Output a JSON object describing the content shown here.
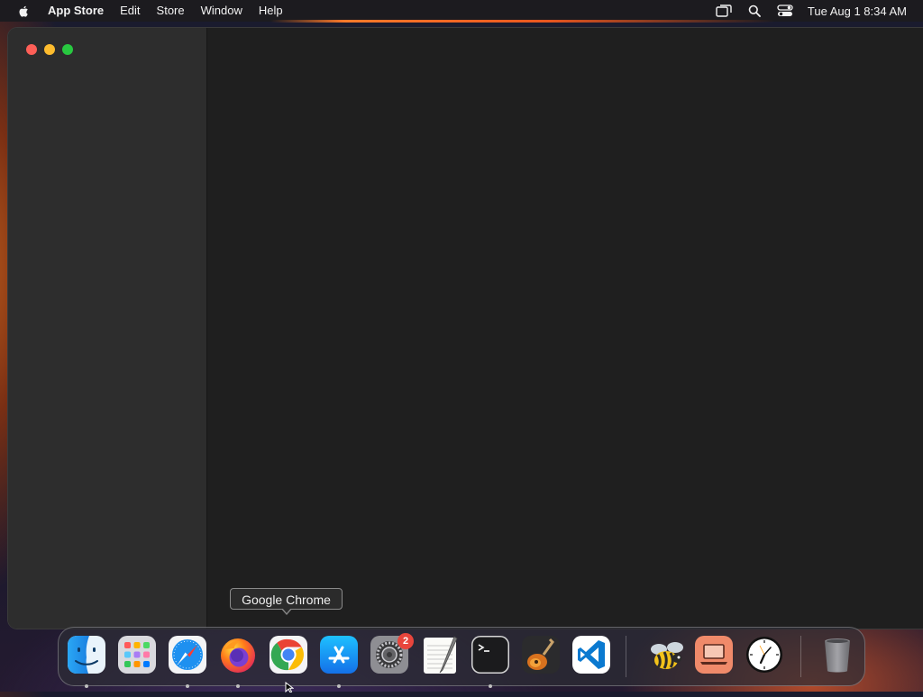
{
  "menubar": {
    "app_name": "App Store",
    "menus": [
      "Edit",
      "Store",
      "Window",
      "Help"
    ],
    "status_icons": [
      "screen-mirroring-icon",
      "search-icon",
      "control-center-icon"
    ],
    "clock": "Tue Aug 1  8:34 AM"
  },
  "window": {
    "traffic_lights": [
      "close",
      "minimize",
      "zoom"
    ]
  },
  "tooltip": {
    "text": "Google Chrome"
  },
  "dock": {
    "items": [
      {
        "name": "Finder",
        "icon": "finder-icon",
        "running": true
      },
      {
        "name": "Launchpad",
        "icon": "launchpad-icon",
        "running": false
      },
      {
        "name": "Safari",
        "icon": "safari-icon",
        "running": true
      },
      {
        "name": "Firefox",
        "icon": "firefox-icon",
        "running": true
      },
      {
        "name": "Google Chrome",
        "icon": "chrome-icon",
        "running": false
      },
      {
        "name": "App Store",
        "icon": "app-store-icon",
        "running": true
      },
      {
        "name": "System Settings",
        "icon": "settings-icon",
        "running": false,
        "badge": "2"
      },
      {
        "name": "TextEdit",
        "icon": "textedit-icon",
        "running": false
      },
      {
        "name": "Terminal",
        "icon": "terminal-icon",
        "running": true
      },
      {
        "name": "GarageBand",
        "icon": "garageband-icon",
        "running": false
      },
      {
        "name": "Visual Studio Code",
        "icon": "vscode-icon",
        "running": false
      },
      {
        "name": "Bee App",
        "icon": "bee-icon",
        "running": false
      },
      {
        "name": "Laptop App",
        "icon": "laptop-icon",
        "running": false
      },
      {
        "name": "Clock",
        "icon": "clock-icon",
        "running": false
      },
      {
        "name": "Trash",
        "icon": "trash-icon",
        "running": false
      }
    ]
  }
}
